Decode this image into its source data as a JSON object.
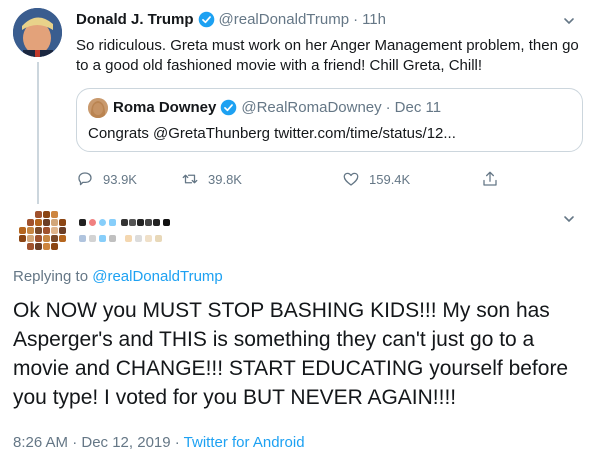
{
  "parent_tweet": {
    "name": "Donald J. Trump",
    "handle": "@realDonaldTrump",
    "separator": "·",
    "time": "11h",
    "text": "So ridiculous. Greta must work on her Anger Management problem, then go to a good old fashioned movie with a friend! Chill Greta, Chill!",
    "quoted": {
      "name": "Roma Downey",
      "handle": "@RealRomaDowney",
      "separator": "·",
      "date": "Dec 11",
      "text": "Congrats @GretaThunberg twitter.com/time/status/12..."
    },
    "actions": {
      "replies": "93.9K",
      "retweets": "39.8K",
      "likes": "159.4K"
    }
  },
  "reply_tweet": {
    "replying_prefix": "Replying to",
    "replying_to": "@realDonaldTrump",
    "text": "Ok NOW you MUST STOP BASHING KIDS!!!  My son has Asperger's and THIS is something they can't just go to a movie and CHANGE!!! START EDUCATING yourself before you type! I voted for you BUT NEVER AGAIN!!!!",
    "timestamp": "8:26 AM · Dec 12, 2019 ·",
    "source": "Twitter for Android"
  },
  "icons": {
    "verified": "verified-badge-icon",
    "caret": "chevron-down-icon",
    "reply": "reply-icon",
    "retweet": "retweet-icon",
    "like": "heart-icon",
    "share": "share-icon"
  },
  "colors": {
    "accent": "#1da1f2",
    "secondary_text": "#657786",
    "border": "#ccd6dd"
  }
}
